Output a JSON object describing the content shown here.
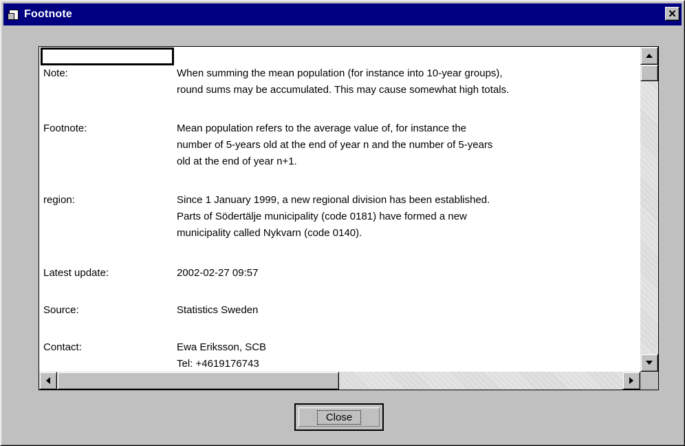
{
  "window": {
    "title": "Footnote",
    "close_glyph": "✕"
  },
  "grid": {
    "header_cell": "",
    "rows": [
      {
        "label": "Note:",
        "lines": [
          "When summing the mean population (for instance into 10-year groups),",
          " round sums may be accumulated. This may cause somewhat high totals."
        ]
      },
      {
        "label": "Footnote:",
        "lines": [
          "Mean population refers to the average value of, for instance the",
          "number of 5-years old at the end of year n and the number of 5-years",
          "old at the end of year n+1."
        ]
      },
      {
        "label": "region:",
        "lines": [
          "Since 1 January 1999, a new regional division has been established.",
          "Parts of Södertälje municipality (code 0181) have formed a new",
          "municipality called Nykvarn (code 0140)."
        ]
      },
      {
        "label": "Latest update:",
        "lines": [
          "2002-02-27 09:57"
        ]
      },
      {
        "label": "Source:",
        "lines": [
          "Statistics Sweden"
        ]
      },
      {
        "label": "Contact:",
        "lines": [
          "Ewa Eriksson, SCB",
          "Tel: +4619176743"
        ]
      }
    ]
  },
  "buttons": {
    "close_label": "Close"
  },
  "icons": {
    "app": "document-folder-icon",
    "scroll_up": "arrow-up-icon",
    "scroll_down": "arrow-down-icon",
    "scroll_left": "arrow-left-icon",
    "scroll_right": "arrow-right-icon"
  },
  "colors": {
    "titlebar": "#000080",
    "face": "#c0c0c0",
    "grid_bg": "#ffffff"
  }
}
